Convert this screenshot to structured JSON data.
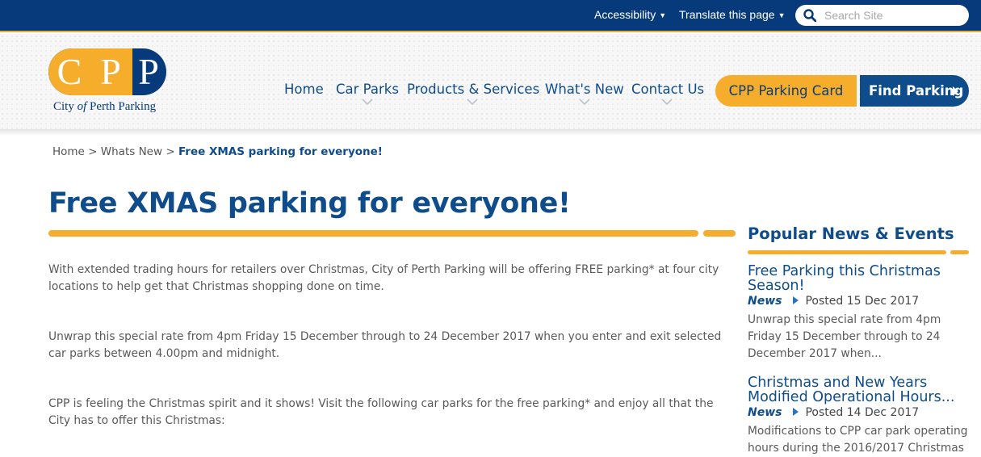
{
  "utility": {
    "accessibility_label": "Accessibility",
    "translate_label": "Translate this page",
    "search_placeholder": "Search Site"
  },
  "logo": {
    "letters": [
      "C",
      "P",
      "P"
    ],
    "tagline_prefix": "City",
    "tagline_of": "of",
    "tagline_suffix": "Perth Parking"
  },
  "nav": {
    "items": [
      {
        "label": "Home"
      },
      {
        "label": "Car Parks"
      },
      {
        "label": "Products & Services"
      },
      {
        "label": "What's New"
      },
      {
        "label": "Contact Us"
      }
    ],
    "cta_card": "CPP Parking Card",
    "cta_find": "Find Parking"
  },
  "breadcrumb": {
    "home": "Home",
    "sep": ">",
    "section": "Whats New",
    "current": "Free XMAS parking for everyone!"
  },
  "article": {
    "title": "Free XMAS parking for everyone!",
    "paragraphs": [
      "With extended trading hours for retailers over Christmas, City of Perth Parking will be offering FREE parking* at four city locations to help get that Christmas shopping done on time.",
      "Unwrap this special rate from 4pm Friday 15 December through to 24 December 2017 when you enter and exit selected car parks between 4.00pm and midnight.",
      "CPP is feeling the Christmas spirit and it shows! Visit the following car parks for the free parking* and enjoy all that the City has to offer this Christmas:"
    ]
  },
  "sidebar": {
    "title": "Popular News & Events",
    "items": [
      {
        "title": "Free Parking this Christmas Season!",
        "category": "News",
        "posted": "Posted 15 Dec 2017",
        "summary": "Unwrap this special rate from 4pm Friday 15 December through to 24 December 2017 when..."
      },
      {
        "title": "Christmas and New Years Modified Operational Hours...",
        "category": "News",
        "posted": "Posted 14 Dec 2017",
        "summary": "Modifications to CPP car park operating hours during the 2016/2017 Christmas"
      }
    ]
  },
  "colors": {
    "brand_blue": "#063a7a",
    "link_blue": "#0e4c8c",
    "accent_yellow": "#f6ad2b"
  }
}
